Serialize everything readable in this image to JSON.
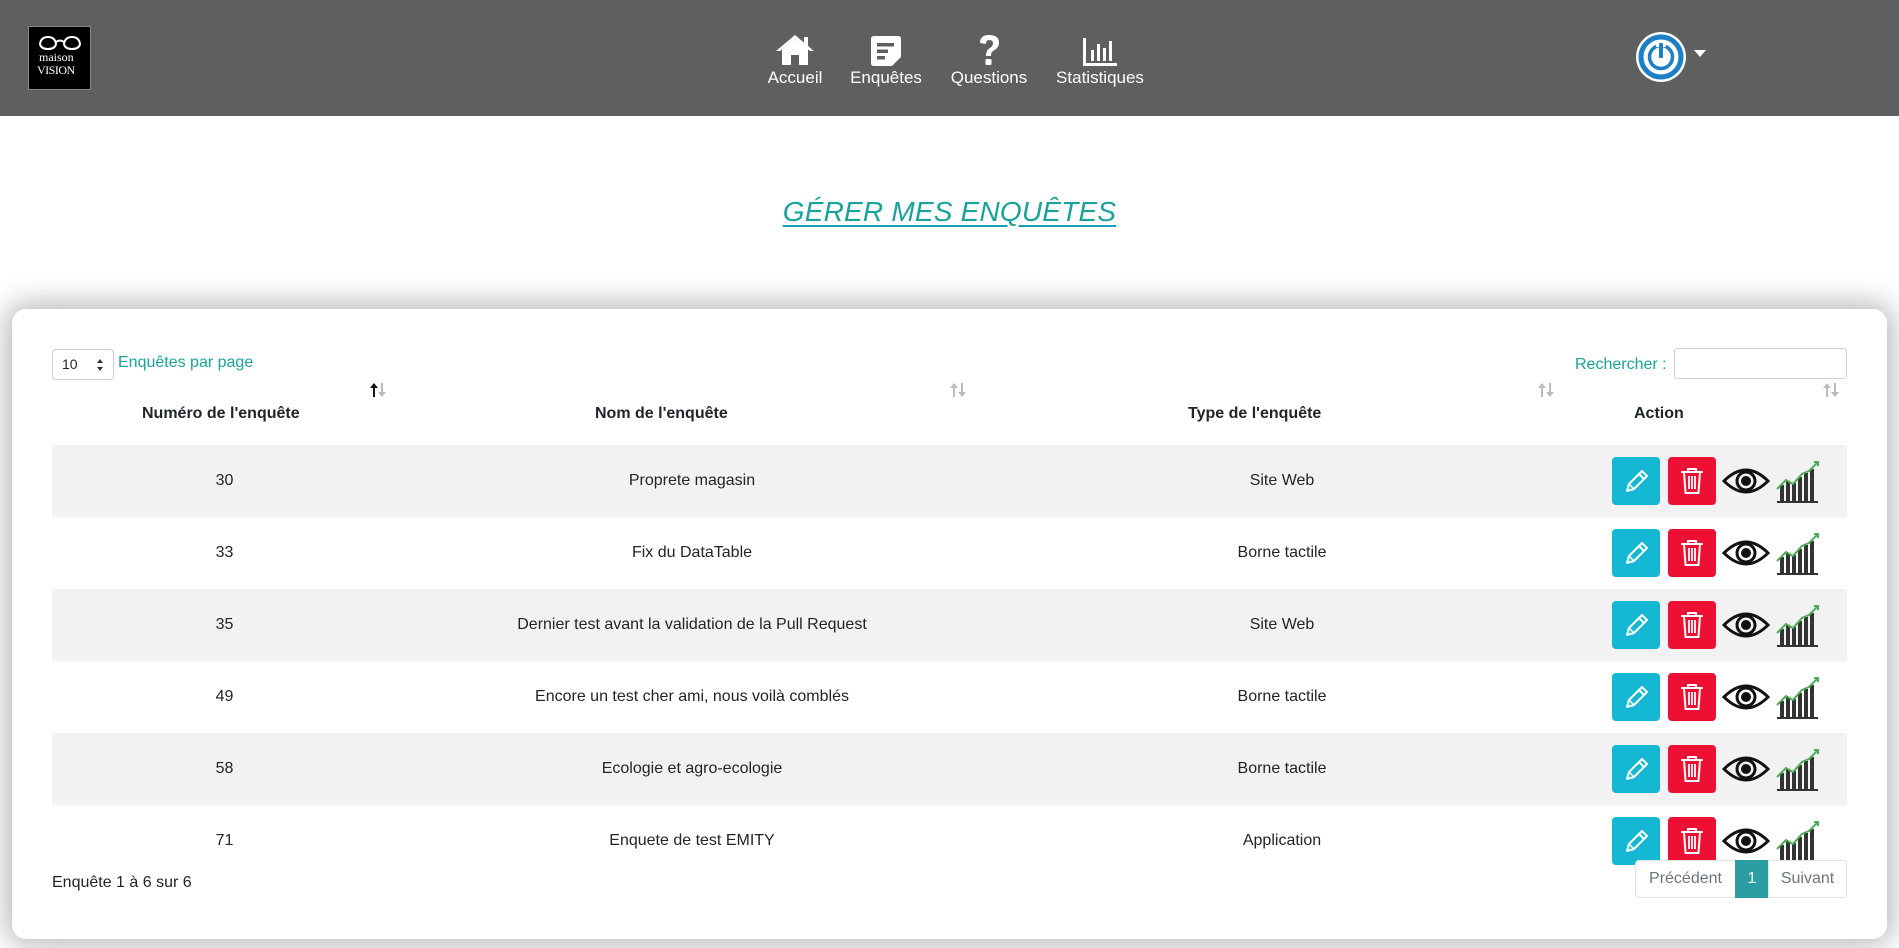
{
  "header": {
    "logo": {
      "line1": "maison",
      "line2": "VISION"
    },
    "nav": [
      {
        "label": "Accueil",
        "icon": "home-icon"
      },
      {
        "label": "Enquêtes",
        "icon": "survey-icon"
      },
      {
        "label": "Questions",
        "icon": "question-icon"
      },
      {
        "label": "Statistiques",
        "icon": "bar-chart-icon"
      }
    ],
    "user_menu": {
      "icon": "power-icon"
    }
  },
  "page_title": "GÉRER MES ENQUÊTES",
  "table_controls": {
    "page_length": "10",
    "page_length_label": "Enquêtes par page",
    "search_label": "Rechercher :",
    "search_value": ""
  },
  "table": {
    "columns": [
      "Numéro de l'enquête",
      "Nom de l'enquête",
      "Type de l'enquête",
      "Action"
    ],
    "rows": [
      {
        "id": "30",
        "name": "Proprete magasin",
        "type": "Site Web"
      },
      {
        "id": "33",
        "name": "Fix du DataTable",
        "type": "Borne tactile"
      },
      {
        "id": "35",
        "name": "Dernier test avant la validation de la Pull Request",
        "type": "Site Web"
      },
      {
        "id": "49",
        "name": "Encore un test cher ami, nous voilà comblés",
        "type": "Borne tactile"
      },
      {
        "id": "58",
        "name": "Ecologie et agro-ecologie",
        "type": "Borne tactile"
      },
      {
        "id": "71",
        "name": "Enquete de test EMITY",
        "type": "Application"
      }
    ],
    "action_icons": [
      "pencil-icon",
      "trash-icon",
      "eye-icon",
      "stats-icon"
    ]
  },
  "footer": {
    "info": "Enquête 1 à 6 sur 6",
    "pagination": {
      "previous": "Précédent",
      "current": "1",
      "next": "Suivant"
    }
  },
  "colors": {
    "header_bg": "#5f5f5f",
    "accent": "#1aa39a",
    "edit_button": "#14b8d2",
    "delete_button": "#ee1033",
    "power_icon": "#1d7fc4"
  }
}
